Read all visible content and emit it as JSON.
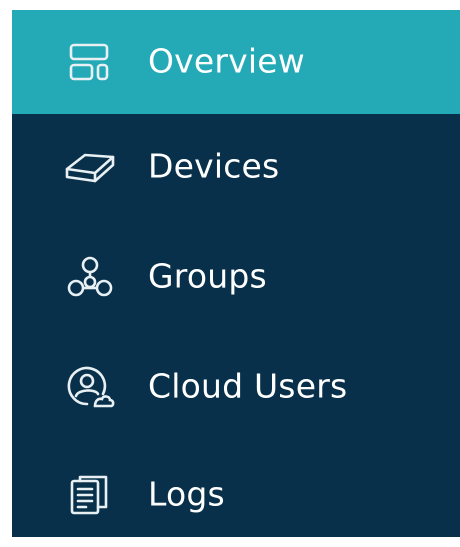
{
  "sidebar": {
    "items": [
      {
        "label": "Overview",
        "icon": "layout-grid-icon",
        "active": true
      },
      {
        "label": "Devices",
        "icon": "device-icon",
        "active": false
      },
      {
        "label": "Groups",
        "icon": "groups-icon",
        "active": false
      },
      {
        "label": "Cloud Users",
        "icon": "cloud-users-icon",
        "active": false
      },
      {
        "label": "Logs",
        "icon": "logs-icon",
        "active": false
      }
    ]
  },
  "colors": {
    "sidebar_bg": "#08304a",
    "active_bg": "#24aab6",
    "text": "#ffffff",
    "icon_stroke": "#e8f0f3"
  }
}
